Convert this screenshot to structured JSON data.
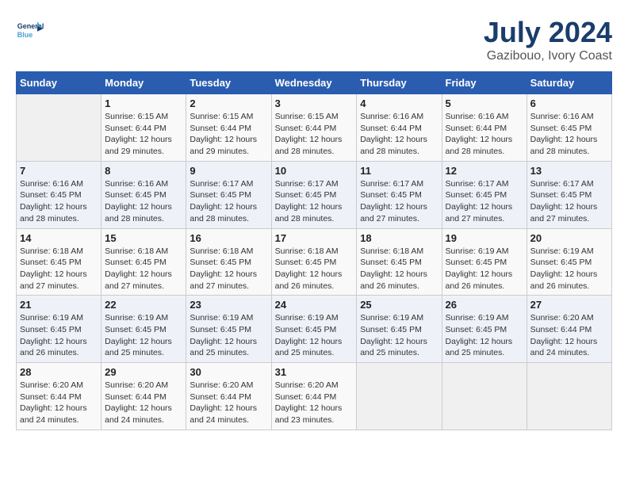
{
  "header": {
    "logo_line1": "General",
    "logo_line2": "Blue",
    "month": "July 2024",
    "location": "Gazibouo, Ivory Coast"
  },
  "days_of_week": [
    "Sunday",
    "Monday",
    "Tuesday",
    "Wednesday",
    "Thursday",
    "Friday",
    "Saturday"
  ],
  "weeks": [
    [
      {
        "day": "",
        "sunrise": "",
        "sunset": "",
        "daylight": ""
      },
      {
        "day": "1",
        "sunrise": "Sunrise: 6:15 AM",
        "sunset": "Sunset: 6:44 PM",
        "daylight": "Daylight: 12 hours and 29 minutes."
      },
      {
        "day": "2",
        "sunrise": "Sunrise: 6:15 AM",
        "sunset": "Sunset: 6:44 PM",
        "daylight": "Daylight: 12 hours and 29 minutes."
      },
      {
        "day": "3",
        "sunrise": "Sunrise: 6:15 AM",
        "sunset": "Sunset: 6:44 PM",
        "daylight": "Daylight: 12 hours and 28 minutes."
      },
      {
        "day": "4",
        "sunrise": "Sunrise: 6:16 AM",
        "sunset": "Sunset: 6:44 PM",
        "daylight": "Daylight: 12 hours and 28 minutes."
      },
      {
        "day": "5",
        "sunrise": "Sunrise: 6:16 AM",
        "sunset": "Sunset: 6:44 PM",
        "daylight": "Daylight: 12 hours and 28 minutes."
      },
      {
        "day": "6",
        "sunrise": "Sunrise: 6:16 AM",
        "sunset": "Sunset: 6:45 PM",
        "daylight": "Daylight: 12 hours and 28 minutes."
      }
    ],
    [
      {
        "day": "7",
        "sunrise": "Sunrise: 6:16 AM",
        "sunset": "Sunset: 6:45 PM",
        "daylight": "Daylight: 12 hours and 28 minutes."
      },
      {
        "day": "8",
        "sunrise": "Sunrise: 6:16 AM",
        "sunset": "Sunset: 6:45 PM",
        "daylight": "Daylight: 12 hours and 28 minutes."
      },
      {
        "day": "9",
        "sunrise": "Sunrise: 6:17 AM",
        "sunset": "Sunset: 6:45 PM",
        "daylight": "Daylight: 12 hours and 28 minutes."
      },
      {
        "day": "10",
        "sunrise": "Sunrise: 6:17 AM",
        "sunset": "Sunset: 6:45 PM",
        "daylight": "Daylight: 12 hours and 28 minutes."
      },
      {
        "day": "11",
        "sunrise": "Sunrise: 6:17 AM",
        "sunset": "Sunset: 6:45 PM",
        "daylight": "Daylight: 12 hours and 27 minutes."
      },
      {
        "day": "12",
        "sunrise": "Sunrise: 6:17 AM",
        "sunset": "Sunset: 6:45 PM",
        "daylight": "Daylight: 12 hours and 27 minutes."
      },
      {
        "day": "13",
        "sunrise": "Sunrise: 6:17 AM",
        "sunset": "Sunset: 6:45 PM",
        "daylight": "Daylight: 12 hours and 27 minutes."
      }
    ],
    [
      {
        "day": "14",
        "sunrise": "Sunrise: 6:18 AM",
        "sunset": "Sunset: 6:45 PM",
        "daylight": "Daylight: 12 hours and 27 minutes."
      },
      {
        "day": "15",
        "sunrise": "Sunrise: 6:18 AM",
        "sunset": "Sunset: 6:45 PM",
        "daylight": "Daylight: 12 hours and 27 minutes."
      },
      {
        "day": "16",
        "sunrise": "Sunrise: 6:18 AM",
        "sunset": "Sunset: 6:45 PM",
        "daylight": "Daylight: 12 hours and 27 minutes."
      },
      {
        "day": "17",
        "sunrise": "Sunrise: 6:18 AM",
        "sunset": "Sunset: 6:45 PM",
        "daylight": "Daylight: 12 hours and 26 minutes."
      },
      {
        "day": "18",
        "sunrise": "Sunrise: 6:18 AM",
        "sunset": "Sunset: 6:45 PM",
        "daylight": "Daylight: 12 hours and 26 minutes."
      },
      {
        "day": "19",
        "sunrise": "Sunrise: 6:19 AM",
        "sunset": "Sunset: 6:45 PM",
        "daylight": "Daylight: 12 hours and 26 minutes."
      },
      {
        "day": "20",
        "sunrise": "Sunrise: 6:19 AM",
        "sunset": "Sunset: 6:45 PM",
        "daylight": "Daylight: 12 hours and 26 minutes."
      }
    ],
    [
      {
        "day": "21",
        "sunrise": "Sunrise: 6:19 AM",
        "sunset": "Sunset: 6:45 PM",
        "daylight": "Daylight: 12 hours and 26 minutes."
      },
      {
        "day": "22",
        "sunrise": "Sunrise: 6:19 AM",
        "sunset": "Sunset: 6:45 PM",
        "daylight": "Daylight: 12 hours and 25 minutes."
      },
      {
        "day": "23",
        "sunrise": "Sunrise: 6:19 AM",
        "sunset": "Sunset: 6:45 PM",
        "daylight": "Daylight: 12 hours and 25 minutes."
      },
      {
        "day": "24",
        "sunrise": "Sunrise: 6:19 AM",
        "sunset": "Sunset: 6:45 PM",
        "daylight": "Daylight: 12 hours and 25 minutes."
      },
      {
        "day": "25",
        "sunrise": "Sunrise: 6:19 AM",
        "sunset": "Sunset: 6:45 PM",
        "daylight": "Daylight: 12 hours and 25 minutes."
      },
      {
        "day": "26",
        "sunrise": "Sunrise: 6:19 AM",
        "sunset": "Sunset: 6:45 PM",
        "daylight": "Daylight: 12 hours and 25 minutes."
      },
      {
        "day": "27",
        "sunrise": "Sunrise: 6:20 AM",
        "sunset": "Sunset: 6:44 PM",
        "daylight": "Daylight: 12 hours and 24 minutes."
      }
    ],
    [
      {
        "day": "28",
        "sunrise": "Sunrise: 6:20 AM",
        "sunset": "Sunset: 6:44 PM",
        "daylight": "Daylight: 12 hours and 24 minutes."
      },
      {
        "day": "29",
        "sunrise": "Sunrise: 6:20 AM",
        "sunset": "Sunset: 6:44 PM",
        "daylight": "Daylight: 12 hours and 24 minutes."
      },
      {
        "day": "30",
        "sunrise": "Sunrise: 6:20 AM",
        "sunset": "Sunset: 6:44 PM",
        "daylight": "Daylight: 12 hours and 24 minutes."
      },
      {
        "day": "31",
        "sunrise": "Sunrise: 6:20 AM",
        "sunset": "Sunset: 6:44 PM",
        "daylight": "Daylight: 12 hours and 23 minutes."
      },
      {
        "day": "",
        "sunrise": "",
        "sunset": "",
        "daylight": ""
      },
      {
        "day": "",
        "sunrise": "",
        "sunset": "",
        "daylight": ""
      },
      {
        "day": "",
        "sunrise": "",
        "sunset": "",
        "daylight": ""
      }
    ]
  ]
}
